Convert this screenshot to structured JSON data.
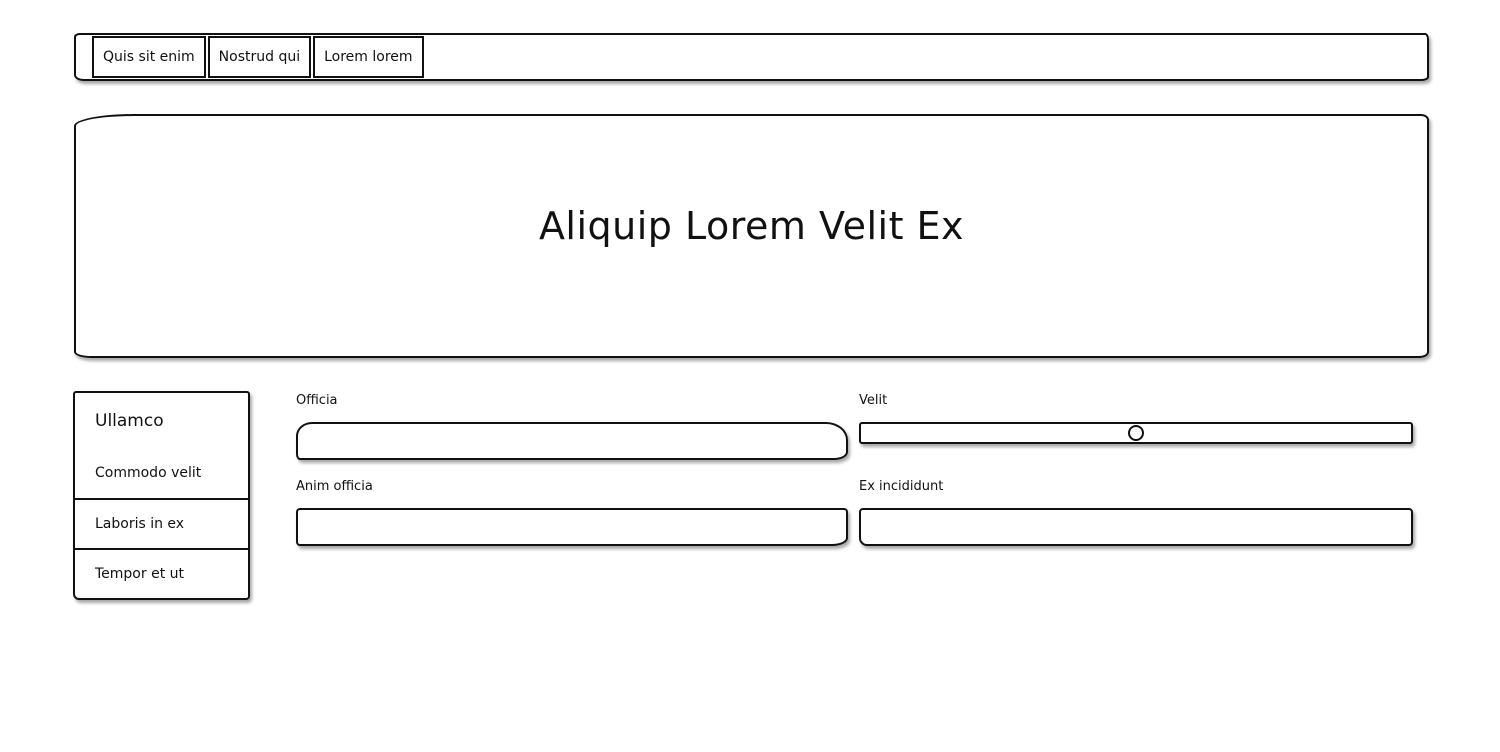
{
  "nav": {
    "tabs": [
      {
        "label": "Quis sit enim"
      },
      {
        "label": "Nostrud qui"
      },
      {
        "label": "Lorem lorem"
      }
    ]
  },
  "hero": {
    "title": "Aliquip Lorem Velit Ex"
  },
  "sidebar": {
    "title": "Ullamco",
    "items": [
      {
        "label": "Commodo velit"
      },
      {
        "label": "Laboris in ex"
      },
      {
        "label": "Tempor et ut"
      }
    ]
  },
  "form": {
    "officia": {
      "label": "Officia",
      "value": ""
    },
    "velit": {
      "label": "Velit",
      "slider_fraction": 0.5
    },
    "anim_officia": {
      "label": "Anim officia",
      "value": ""
    },
    "ex_incididunt": {
      "label": "Ex incididunt",
      "value": ""
    }
  }
}
